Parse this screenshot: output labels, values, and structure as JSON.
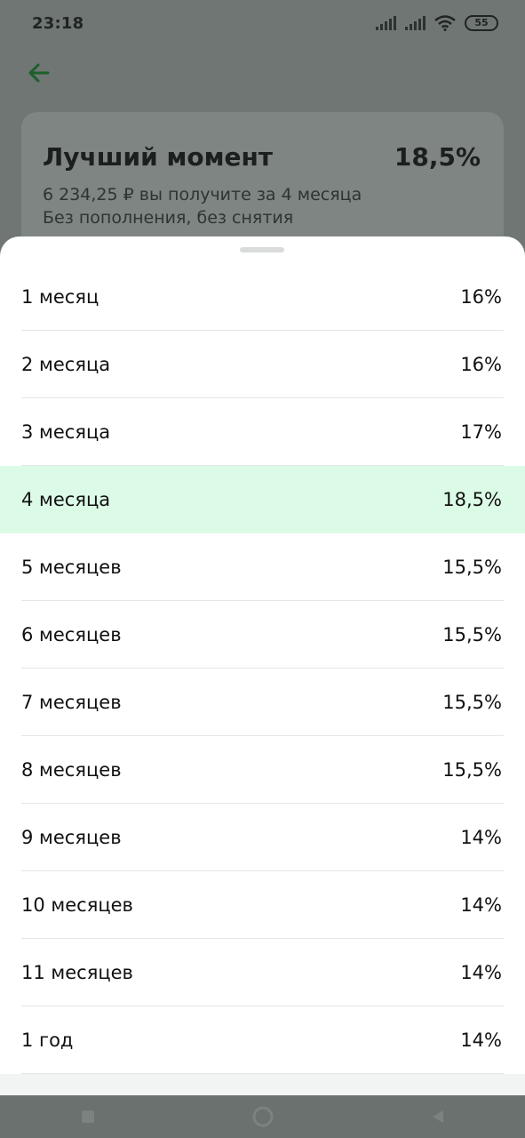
{
  "status_bar": {
    "time": "23:18",
    "battery": "55"
  },
  "background_card": {
    "title": "Лучший момент",
    "rate": "18,5%",
    "line1": "6 234,25 ₽ вы получите за 4 месяца",
    "line2": "Без пополнения, без снятия"
  },
  "sheet": {
    "selected_index": 3,
    "items": [
      {
        "label": "1 месяц",
        "rate": "16%"
      },
      {
        "label": "2 месяца",
        "rate": "16%"
      },
      {
        "label": "3 месяца",
        "rate": "17%"
      },
      {
        "label": "4 месяца",
        "rate": "18,5%"
      },
      {
        "label": "5 месяцев",
        "rate": "15,5%"
      },
      {
        "label": "6 месяцев",
        "rate": "15,5%"
      },
      {
        "label": "7 месяцев",
        "rate": "15,5%"
      },
      {
        "label": "8 месяцев",
        "rate": "15,5%"
      },
      {
        "label": "9 месяцев",
        "rate": "14%"
      },
      {
        "label": "10 месяцев",
        "rate": "14%"
      },
      {
        "label": "11 месяцев",
        "rate": "14%"
      },
      {
        "label": "1 год",
        "rate": "14%"
      }
    ]
  },
  "colors": {
    "accent": "#21a038",
    "selected_row": "#dcfbe6",
    "scrim": "#6f7674"
  }
}
